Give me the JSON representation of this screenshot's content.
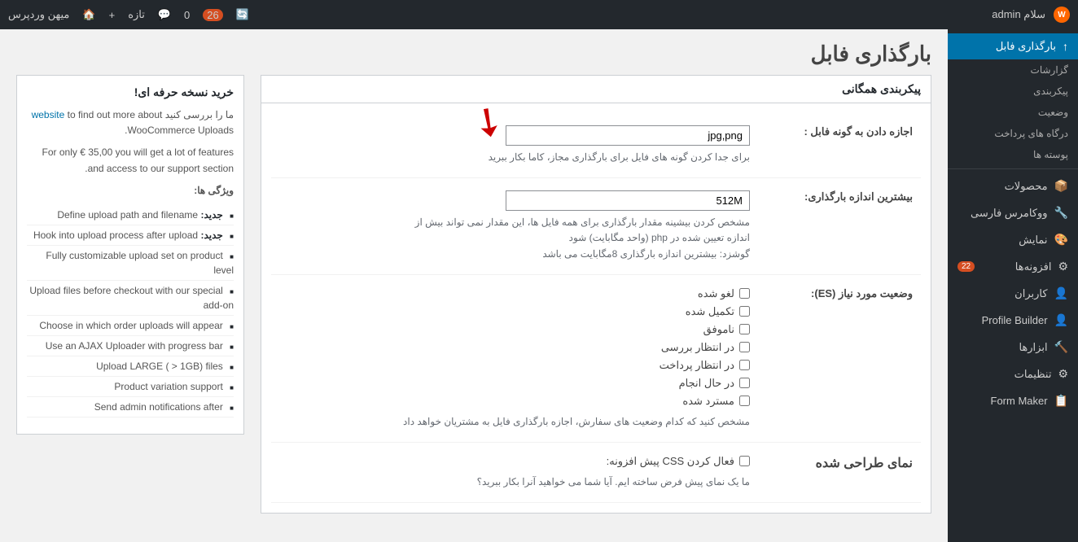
{
  "adminbar": {
    "site_name": "میهن وردپرس",
    "greeting": "سلام admin",
    "new_label": "تازه",
    "comments_count": "0",
    "updates_count": "26",
    "wp_icon": "W"
  },
  "sidebar": {
    "items": [
      {
        "id": "uploads",
        "label": "بارگذاری فابل",
        "icon": "↑",
        "active": true
      },
      {
        "id": "reports",
        "label": "گزارشات",
        "icon": ""
      },
      {
        "id": "settings",
        "label": "پیکربندی",
        "icon": ""
      },
      {
        "id": "status",
        "label": "وضعیت",
        "icon": ""
      },
      {
        "id": "gateways",
        "label": "درگاه های پرداخت",
        "icon": ""
      },
      {
        "id": "posts",
        "label": "پوسته ها",
        "icon": ""
      },
      {
        "id": "products",
        "label": "محصولات",
        "icon": "📦"
      },
      {
        "id": "woo-fa",
        "label": "ووکامرس فارسی",
        "icon": "🔧"
      },
      {
        "id": "appearance",
        "label": "نمایش",
        "icon": "🎨"
      },
      {
        "id": "plugins",
        "label": "افزونه‌ها",
        "icon": "⚙",
        "badge": "22"
      },
      {
        "id": "users",
        "label": "کاربران",
        "icon": "👤"
      },
      {
        "id": "profile-builder",
        "label": "Profile Builder",
        "icon": "👤"
      },
      {
        "id": "tools",
        "label": "ابزارها",
        "icon": "🔨"
      },
      {
        "id": "settings2",
        "label": "تنظیمات",
        "icon": "⚙"
      },
      {
        "id": "form-maker",
        "label": "Form Maker",
        "icon": "📋"
      }
    ]
  },
  "page": {
    "title": "بارگذاری فابل",
    "section_heading": "پیکربندی همگانی"
  },
  "form": {
    "allowed_types_label": "اجازه دادن به گونه فابل :",
    "allowed_types_value": "jpg,png",
    "allowed_types_desc": "برای جدا کردن گونه های فایل برای بارگذاری مجاز، کاما بکار ببرید",
    "max_size_label": "بیشترین اندازه بارگذاری:",
    "max_size_value": "512M",
    "max_size_desc1": "مشخص کردن بیشینه مقدار بارگذاری برای همه فایل ها، این مقدار نمی تواند بیش از",
    "max_size_desc2": "اندازه تعیین شده در php (واحد مگابایت) شود",
    "max_size_desc3": "گوشزد: بیشترین اندازه بارگذاری 8مگابایت می باشد",
    "status_label": "وضعیت مورد نیاز (ES):",
    "statuses": [
      {
        "id": "cancelled",
        "label": "لغو شده"
      },
      {
        "id": "completed",
        "label": "تکمیل شده"
      },
      {
        "id": "failed",
        "label": "ناموفق"
      },
      {
        "id": "pending",
        "label": "در انتظار بررسی"
      },
      {
        "id": "pending-payment",
        "label": "در انتظار پرداخت"
      },
      {
        "id": "processing",
        "label": "در حال انجام"
      },
      {
        "id": "refunded",
        "label": "مسترد شده"
      }
    ],
    "status_desc": "مشخص کنید که کدام وضعیت های سفارش، اجازه بارگذاری فایل به مشتریان خواهد داد",
    "custom_css_label": "نمای طراحی شده",
    "custom_css_checkbox_label": "فعال کردن CSS پیش افزونه:",
    "custom_css_desc": "ما یک نمای پیش فرض ساخته ایم. آیا شما می خواهید آنرا بکار ببرید؟"
  },
  "promo": {
    "title": "خرید نسخه حرفه ای!",
    "intro1": "ما را بررسی کنید",
    "link_text": "website",
    "intro2": "to find out more about WooCommerce Uploads.",
    "pricing": "For only € 35,00 you will get a lot of features and access to our support section.",
    "features_heading": "ویژگی ها:",
    "features": [
      {
        "badge": "جدید:",
        "text": "Define upload path and filename"
      },
      {
        "badge": "جدید:",
        "text": "Hook into upload process after upload"
      },
      {
        "text": "Fully customizable upload set on product level"
      },
      {
        "text": "Upload files before checkout with our special add-on"
      },
      {
        "text": "Choose in which order uploads will appear"
      },
      {
        "text": "Use an AJAX Uploader with progress bar"
      },
      {
        "text": "Upload LARGE ( > 1GB) files"
      },
      {
        "text": "Product variation support"
      },
      {
        "text": "Send admin notifications after"
      }
    ]
  }
}
